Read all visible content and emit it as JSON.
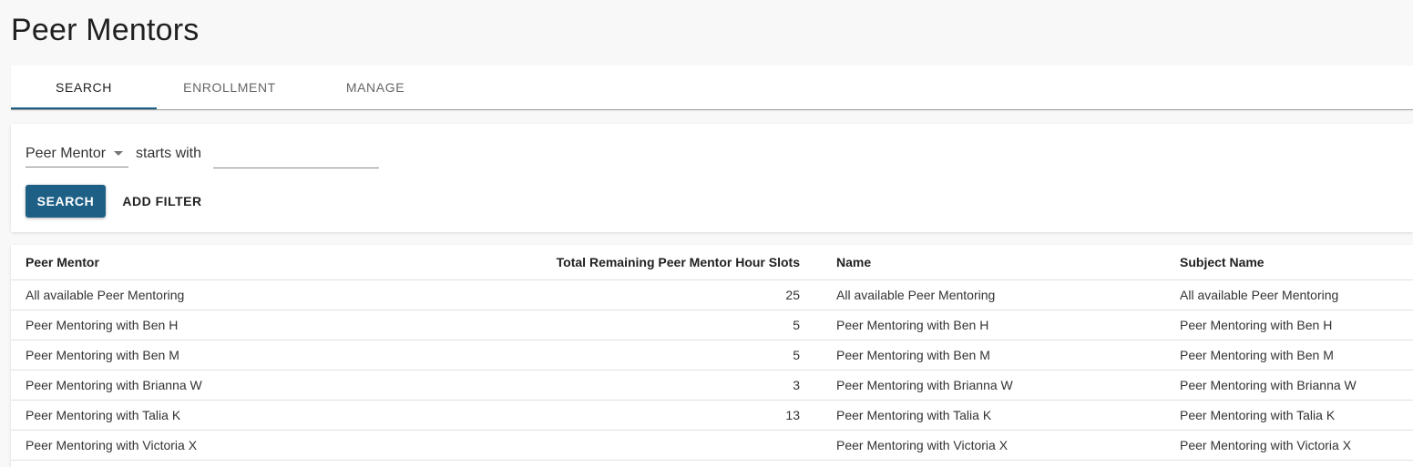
{
  "page": {
    "title": "Peer Mentors"
  },
  "tabs": [
    {
      "label": "SEARCH",
      "active": true
    },
    {
      "label": "ENROLLMENT",
      "active": false
    },
    {
      "label": "MANAGE",
      "active": false
    }
  ],
  "filter": {
    "field": "Peer Mentor",
    "operator": "starts with",
    "value": "",
    "search_label": "SEARCH",
    "add_filter_label": "ADD FILTER"
  },
  "colors": {
    "primary": "#1e5f86",
    "tab_indicator": "#1e5f86"
  },
  "table": {
    "columns": [
      "Peer Mentor",
      "Total Remaining Peer Mentor Hour Slots",
      "Name",
      "Subject Name"
    ],
    "rows": [
      [
        "All available Peer Mentoring",
        "25",
        "All available Peer Mentoring",
        "All available Peer Mentoring"
      ],
      [
        "Peer Mentoring with Ben H",
        "5",
        "Peer Mentoring with Ben H",
        "Peer Mentoring with Ben H"
      ],
      [
        "Peer Mentoring with Ben M",
        "5",
        "Peer Mentoring with Ben M",
        "Peer Mentoring with Ben M"
      ],
      [
        "Peer Mentoring with Brianna W",
        "3",
        "Peer Mentoring with Brianna W",
        "Peer Mentoring with Brianna W"
      ],
      [
        "Peer Mentoring with Talia K",
        "13",
        "Peer Mentoring with Talia K",
        "Peer Mentoring with Talia K"
      ],
      [
        "Peer Mentoring with Victoria X",
        "",
        "Peer Mentoring with Victoria X",
        "Peer Mentoring with Victoria X"
      ]
    ]
  }
}
